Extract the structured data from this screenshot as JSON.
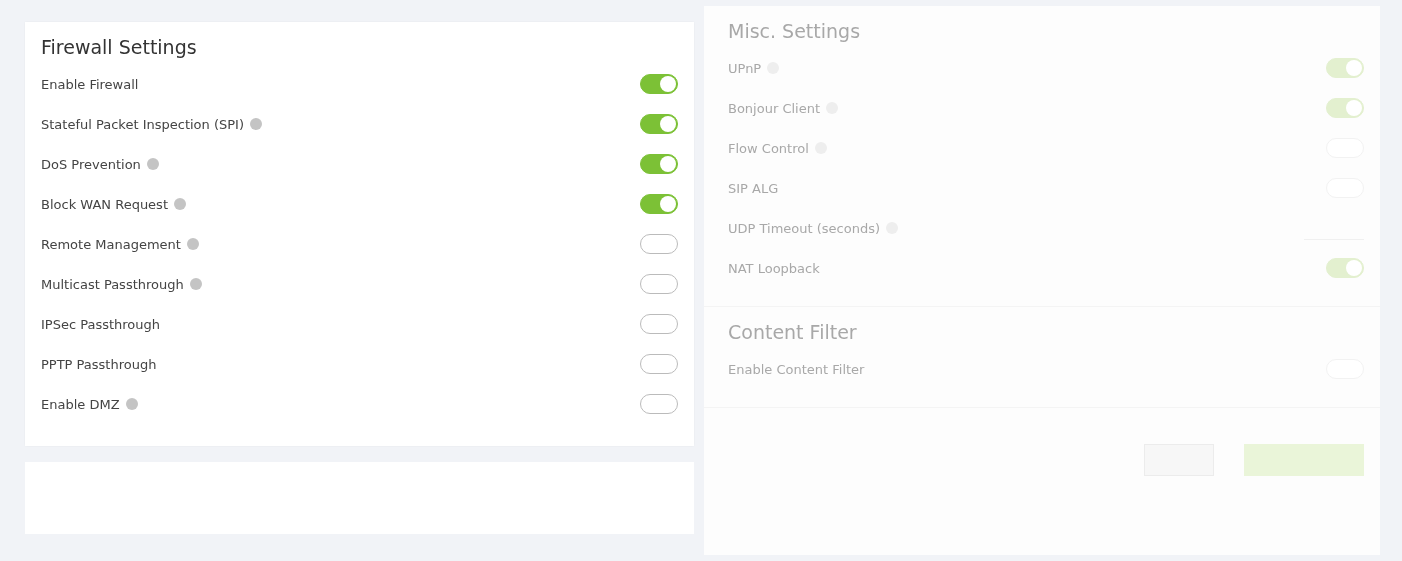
{
  "panels": [
    {
      "title": "Firewall Settings",
      "dimmed": false,
      "items": [
        {
          "label": "Enable Firewall",
          "info": false,
          "kind": "toggle",
          "on": true
        },
        {
          "label": "Stateful Packet Inspection (SPI)",
          "info": true,
          "kind": "toggle",
          "on": true
        },
        {
          "label": "DoS Prevention",
          "info": true,
          "kind": "toggle",
          "on": true
        },
        {
          "label": "Block WAN Request",
          "info": true,
          "kind": "toggle",
          "on": true
        },
        {
          "label": "Remote Management",
          "info": true,
          "kind": "toggle",
          "on": false
        },
        {
          "label": "Multicast Passthrough",
          "info": true,
          "kind": "toggle",
          "on": false
        },
        {
          "label": "IPSec Passthrough",
          "info": false,
          "kind": "toggle",
          "on": false
        },
        {
          "label": "PPTP Passthrough",
          "info": false,
          "kind": "toggle",
          "on": false
        },
        {
          "label": "Enable DMZ",
          "info": true,
          "kind": "toggle",
          "on": false
        }
      ]
    },
    {
      "title": "Misc. Settings",
      "dimmed": true,
      "items": [
        {
          "label": "UPnP",
          "info": true,
          "kind": "toggle",
          "on": true
        },
        {
          "label": "Bonjour Client",
          "info": true,
          "kind": "toggle",
          "on": true
        },
        {
          "label": "Flow Control",
          "info": true,
          "kind": "toggle",
          "on": false
        },
        {
          "label": "SIP ALG",
          "info": false,
          "kind": "toggle",
          "on": false
        },
        {
          "label": "UDP Timeout (seconds)",
          "info": true,
          "kind": "field"
        },
        {
          "label": "NAT Loopback",
          "info": false,
          "kind": "toggle",
          "on": true
        }
      ]
    },
    {
      "title": "Content Filter",
      "dimmed": true,
      "items": [
        {
          "label": "Enable Content Filter",
          "info": false,
          "kind": "toggle",
          "on": false
        }
      ]
    }
  ]
}
